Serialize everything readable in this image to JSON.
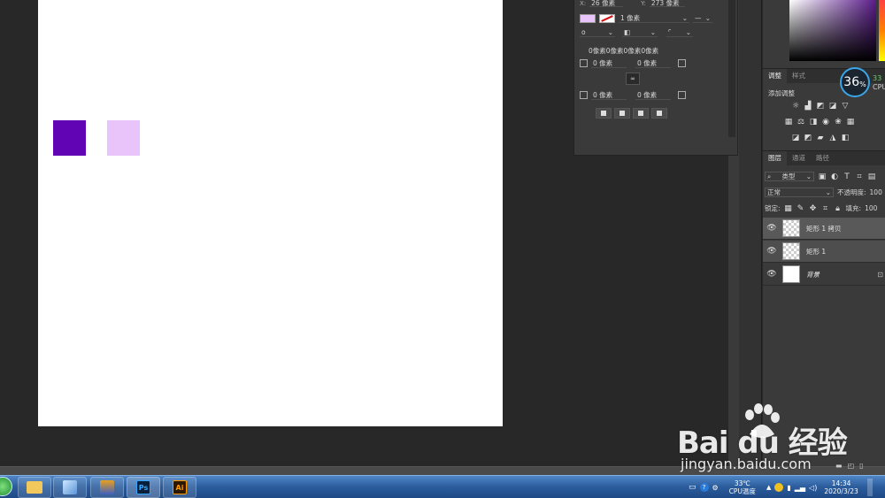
{
  "colors": {
    "rect_dark": "#6004b4",
    "rect_light": "#e8c4fb",
    "canvas": "#ffffff"
  },
  "properties": {
    "x_label": "X:",
    "x_value": "26 像素",
    "y_label": "Y:",
    "y_value": "273 像素",
    "stroke_width": "1 像素",
    "corner_radii": "0像素0像素0像素0像素",
    "radius_tl": "0 像素",
    "radius_tr": "0 像素",
    "radius_bl": "0 像素",
    "radius_br": "0 像素"
  },
  "adjustments": {
    "tab_adjust": "调整",
    "tab_style": "样式",
    "add_label": "添加调整"
  },
  "cpu": {
    "percent": "36",
    "unit": "%",
    "side_value": "33",
    "side_label": "CPU"
  },
  "layers": {
    "tab_layers": "图层",
    "tab_channels": "通道",
    "tab_paths": "路径",
    "filter_kind": "类型",
    "blend_mode": "正常",
    "opacity_label": "不透明度:",
    "opacity_value": "100",
    "lock_label": "锁定:",
    "fill_label": "填充:",
    "fill_value": "100",
    "items": [
      {
        "name": "矩形 1 拷贝"
      },
      {
        "name": "矩形 1"
      },
      {
        "name": "背景"
      }
    ]
  },
  "taskbar": {
    "ps_label": "Ps",
    "ai_label": "Ai",
    "cpu_temp": "33℃",
    "cpu_temp_label": "CPU温度",
    "time": "14:34",
    "date": "2020/3/23"
  },
  "watermark": {
    "logo": "Bai  du 经验",
    "url": "jingyan.baidu.com"
  }
}
